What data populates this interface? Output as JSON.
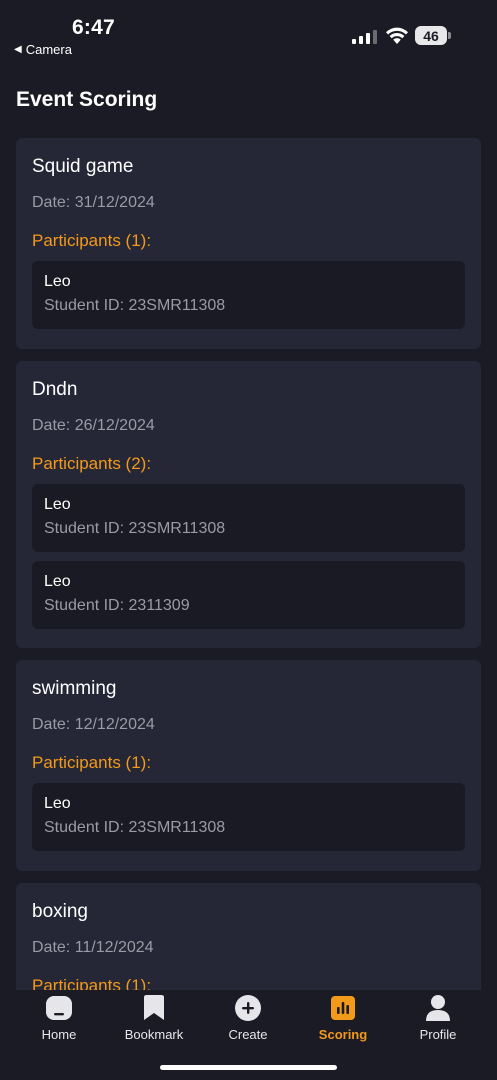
{
  "status_bar": {
    "time": "6:47",
    "back_label": "Camera",
    "battery": "46"
  },
  "header": {
    "title": "Event Scoring"
  },
  "events": [
    {
      "name": "Squid game",
      "date": "Date: 31/12/2024",
      "participants_heading": "Participants (1):",
      "participants": [
        {
          "name": "Leo",
          "student_id": "Student ID: 23SMR11308"
        }
      ]
    },
    {
      "name": "Dndn",
      "date": "Date: 26/12/2024",
      "participants_heading": "Participants (2):",
      "participants": [
        {
          "name": "Leo",
          "student_id": "Student ID: 23SMR11308"
        },
        {
          "name": "Leo",
          "student_id": "Student ID: 2311309"
        }
      ]
    },
    {
      "name": "swimming",
      "date": "Date: 12/12/2024",
      "participants_heading": "Participants (1):",
      "participants": [
        {
          "name": "Leo",
          "student_id": "Student ID: 23SMR11308"
        }
      ]
    },
    {
      "name": "boxing",
      "date": "Date: 11/12/2024",
      "participants_heading": "Participants (1):",
      "participants": []
    }
  ],
  "tab_bar": {
    "items": [
      {
        "label": "Home",
        "icon": "home-icon"
      },
      {
        "label": "Bookmark",
        "icon": "bookmark-icon"
      },
      {
        "label": "Create",
        "icon": "plus-circle-icon"
      },
      {
        "label": "Scoring",
        "icon": "bar-chart-icon"
      },
      {
        "label": "Profile",
        "icon": "person-icon"
      }
    ],
    "active": "Scoring"
  },
  "colors": {
    "background": "#1b1b26",
    "card": "#252636",
    "participant_box": "#1a1a24",
    "accent": "#f49a1a",
    "muted_text": "#9b9ba6"
  }
}
